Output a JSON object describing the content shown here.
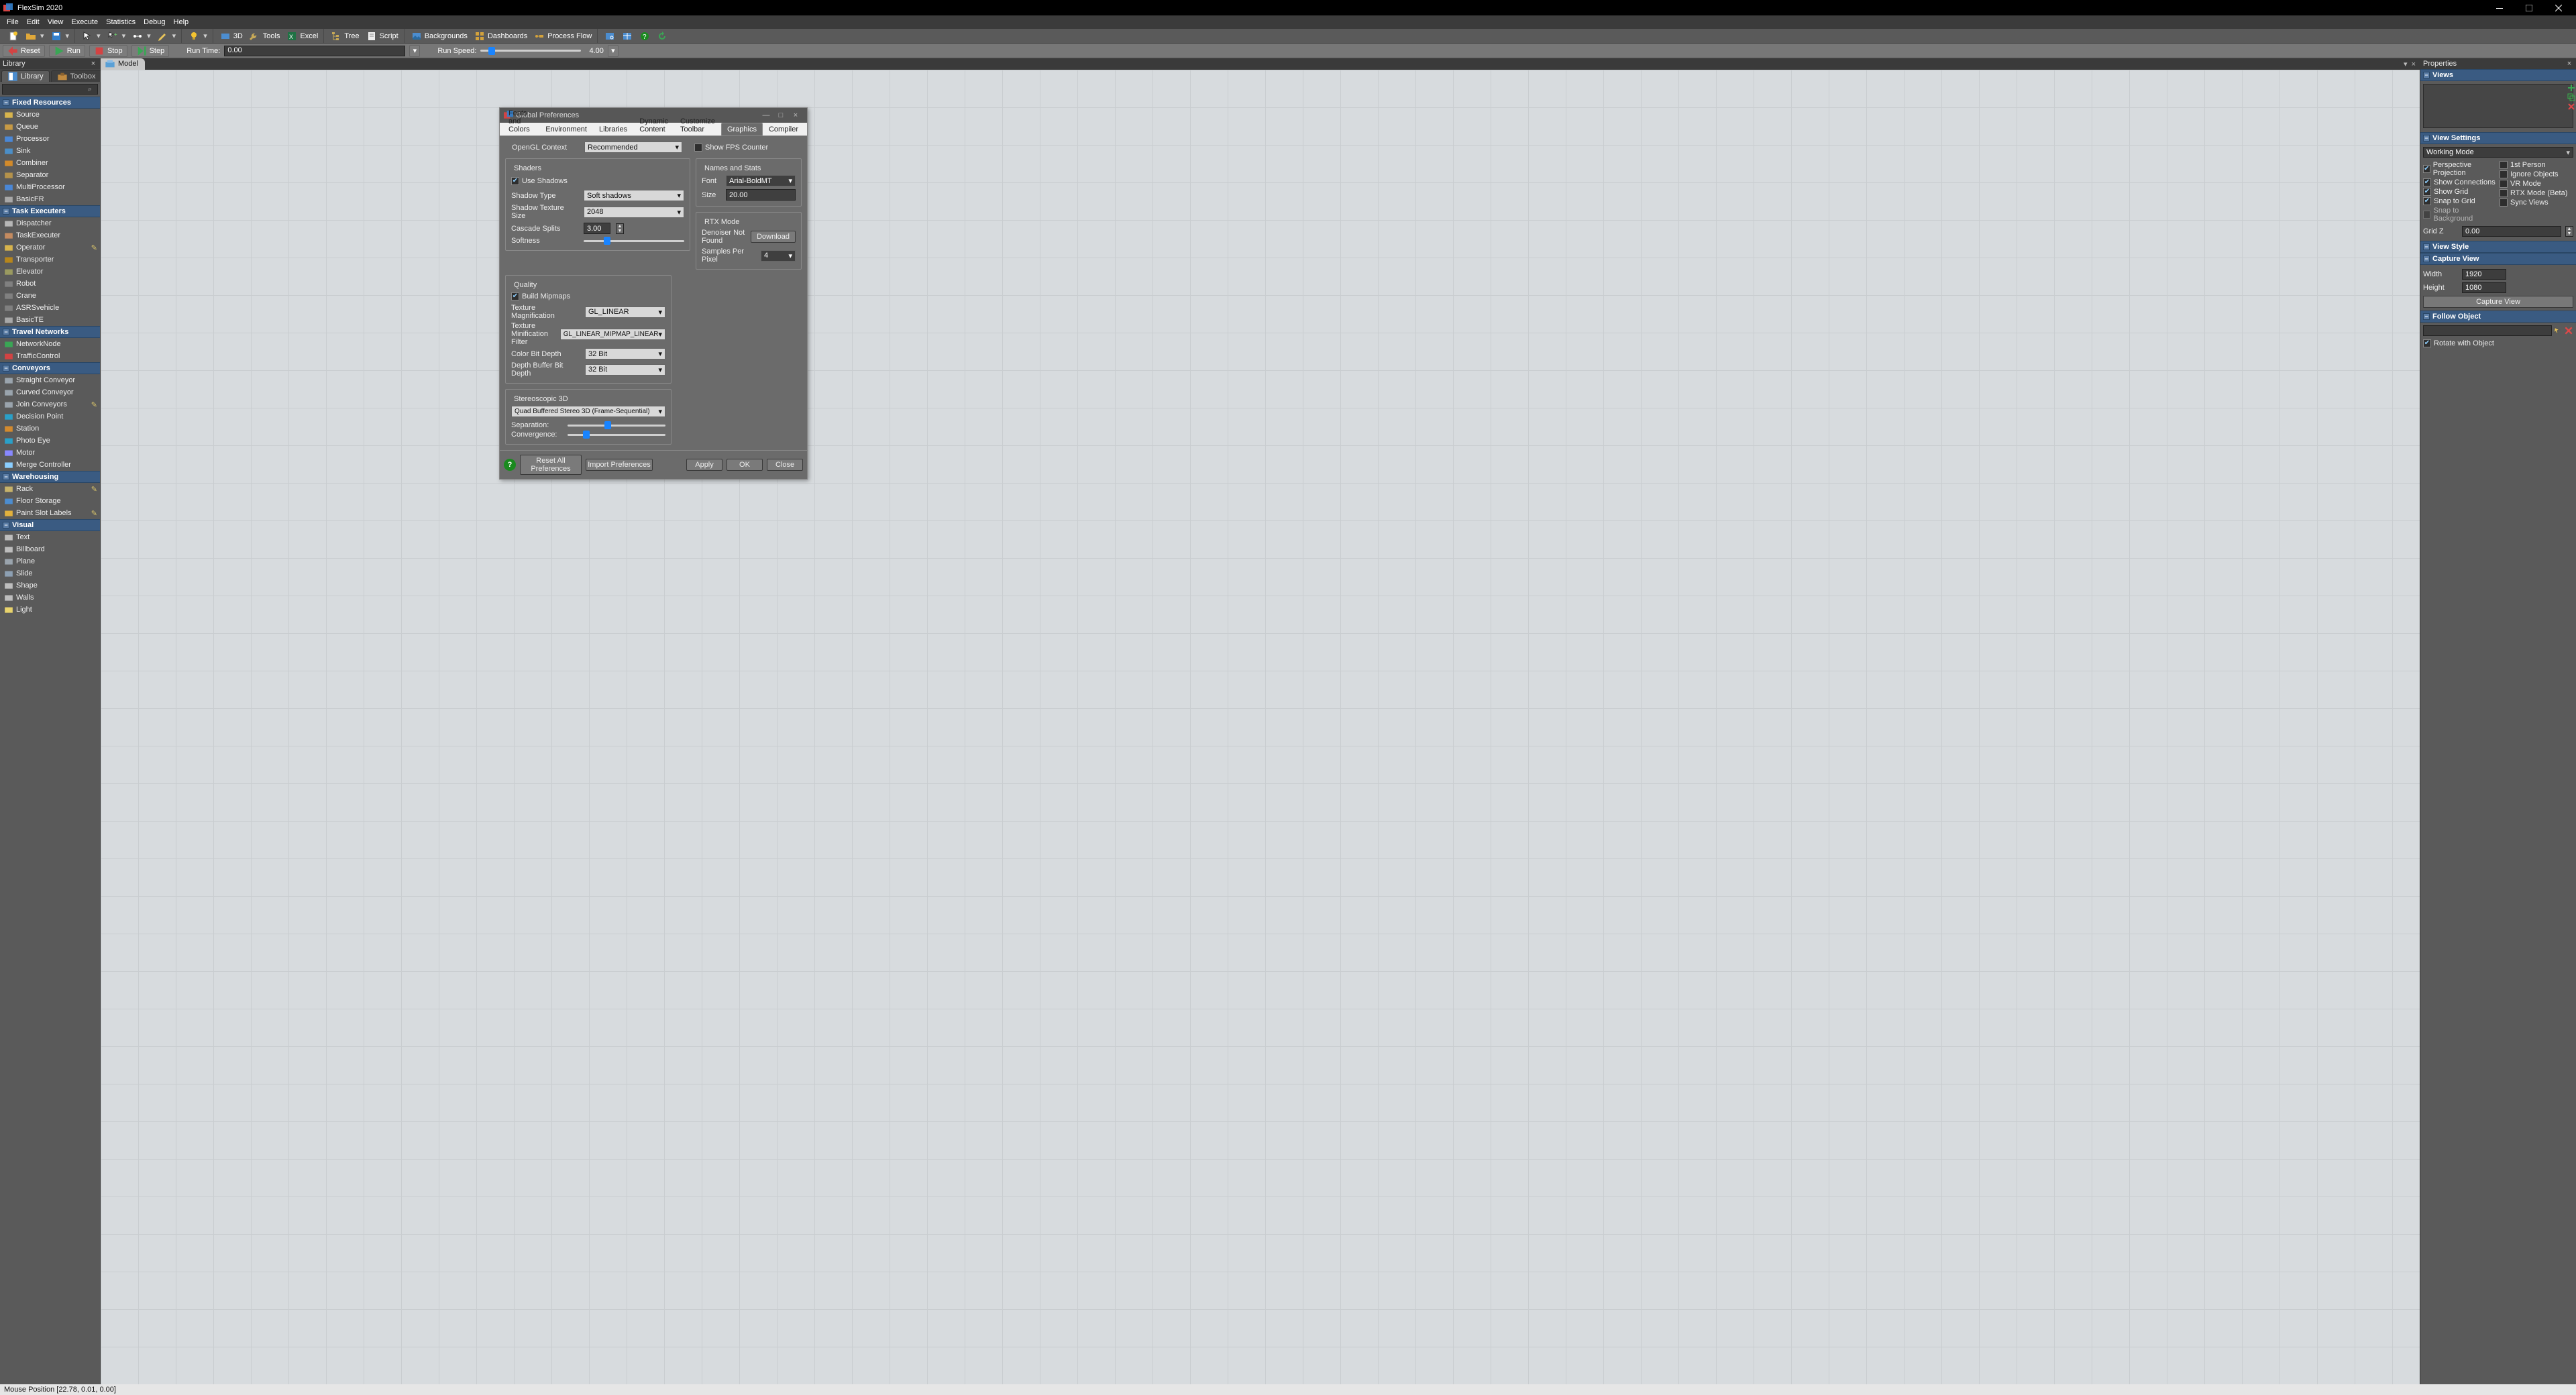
{
  "title": "FlexSim 2020",
  "menubar": [
    "File",
    "Edit",
    "View",
    "Execute",
    "Statistics",
    "Debug",
    "Help"
  ],
  "toolbar": {
    "groups": {
      "view": [
        {
          "name": "3d-toggle",
          "label": "3D"
        },
        {
          "name": "tools-menu",
          "label": "Tools"
        },
        {
          "name": "excel-button",
          "label": "Excel"
        }
      ],
      "tree": [
        {
          "name": "tree-button",
          "label": "Tree"
        },
        {
          "name": "script-button",
          "label": "Script"
        }
      ],
      "layout": [
        {
          "name": "backgrounds-button",
          "label": "Backgrounds"
        },
        {
          "name": "dashboards-button",
          "label": "Dashboards"
        },
        {
          "name": "process-flow-button",
          "label": "Process Flow"
        }
      ]
    }
  },
  "simbar": {
    "reset": "Reset",
    "run": "Run",
    "stop": "Stop",
    "step": "Step",
    "run_time_label": "Run Time:",
    "run_time_value": "0.00",
    "run_speed_label": "Run Speed:",
    "run_speed_value": "4.00",
    "run_speed_pct": 8
  },
  "library": {
    "header": "Library",
    "tabs": {
      "library": "Library",
      "toolbox": "Toolbox"
    },
    "search_placeholder": "",
    "categories": [
      {
        "name": "Fixed Resources",
        "items": [
          {
            "label": "Source",
            "c": "#d7b44d"
          },
          {
            "label": "Queue",
            "c": "#c79a45"
          },
          {
            "label": "Processor",
            "c": "#4a87d6"
          },
          {
            "label": "Sink",
            "c": "#4b8ec7"
          },
          {
            "label": "Combiner",
            "c": "#d28a2a"
          },
          {
            "label": "Separator",
            "c": "#b4924b"
          },
          {
            "label": "MultiProcessor",
            "c": "#4a87d6"
          },
          {
            "label": "BasicFR",
            "c": "#a8a8a8"
          }
        ]
      },
      {
        "name": "Task Executers",
        "items": [
          {
            "label": "Dispatcher",
            "c": "#b7b7b7"
          },
          {
            "label": "TaskExecuter",
            "c": "#c48b60"
          },
          {
            "label": "Operator",
            "c": "#d7b44d",
            "r": true
          },
          {
            "label": "Transporter",
            "c": "#b7861b"
          },
          {
            "label": "Elevator",
            "c": "#9a9a60"
          },
          {
            "label": "Robot",
            "c": "#808080"
          },
          {
            "label": "Crane",
            "c": "#808080"
          },
          {
            "label": "ASRSvehicle",
            "c": "#808080"
          },
          {
            "label": "BasicTE",
            "c": "#a8a8a8"
          }
        ]
      },
      {
        "name": "Travel Networks",
        "items": [
          {
            "label": "NetworkNode",
            "c": "#3aa655"
          },
          {
            "label": "TrafficControl",
            "c": "#d34343"
          }
        ]
      },
      {
        "name": "Conveyors",
        "items": [
          {
            "label": "Straight Conveyor",
            "c": "#9aa4ad"
          },
          {
            "label": "Curved Conveyor",
            "c": "#9aa4ad"
          },
          {
            "label": "Join Conveyors",
            "c": "#9aa4ad",
            "r": true
          },
          {
            "label": "Decision Point",
            "c": "#2aa0c8"
          },
          {
            "label": "Station",
            "c": "#d38a2e"
          },
          {
            "label": "Photo Eye",
            "c": "#2aa0c8"
          },
          {
            "label": "Motor",
            "c": "#8888ff"
          },
          {
            "label": "Merge Controller",
            "c": "#8aceff"
          }
        ]
      },
      {
        "name": "Warehousing",
        "items": [
          {
            "label": "Rack",
            "c": "#c7b26a",
            "r": true
          },
          {
            "label": "Floor Storage",
            "c": "#4c8dcf"
          },
          {
            "label": "Paint Slot Labels",
            "c": "#e2b13d",
            "r": true
          }
        ]
      },
      {
        "name": "Visual",
        "items": [
          {
            "label": "Text",
            "c": "#bdbdbd"
          },
          {
            "label": "Billboard",
            "c": "#bdbdbd"
          },
          {
            "label": "Plane",
            "c": "#9aa4ad"
          },
          {
            "label": "Slide",
            "c": "#8da0b3"
          },
          {
            "label": "Shape",
            "c": "#bdbdbd"
          },
          {
            "label": "Walls",
            "c": "#bdbdbd"
          },
          {
            "label": "Light",
            "c": "#e8d36c"
          }
        ]
      }
    ]
  },
  "view_tab": {
    "label": "Model"
  },
  "properties": {
    "header": "Properties",
    "views": {
      "header": "Views"
    },
    "view_settings": {
      "header": "View Settings",
      "mode": "Working Mode",
      "left": [
        {
          "label": "Perspective Projection",
          "on": true
        },
        {
          "label": "Show Connections",
          "on": true
        },
        {
          "label": "Show Grid",
          "on": true
        },
        {
          "label": "Snap to Grid",
          "on": true
        },
        {
          "label": "Snap to Background",
          "on": false,
          "disabled": true
        }
      ],
      "right": [
        {
          "label": "1st Person",
          "on": false
        },
        {
          "label": "Ignore Objects",
          "on": false
        },
        {
          "label": "VR Mode",
          "on": false
        },
        {
          "label": "RTX Mode (Beta)",
          "on": false
        },
        {
          "label": "Sync Views",
          "on": false
        }
      ],
      "grid_z_label": "Grid Z",
      "grid_z": "0.00"
    },
    "view_style": {
      "header": "View Style"
    },
    "capture_view": {
      "header": "Capture View",
      "width_label": "Width",
      "width": "1920",
      "height_label": "Height",
      "height": "1080",
      "button": "Capture View"
    },
    "follow": {
      "header": "Follow Object",
      "rotate_label": "Rotate with Object",
      "rotate_on": true
    }
  },
  "dialog": {
    "title": "Global Preferences",
    "tabs": [
      "Fonts and Colors",
      "Environment",
      "Libraries",
      "Dynamic Content",
      "Customize Toolbar",
      "Graphics",
      "Compiler"
    ],
    "active_tab": "Graphics",
    "top": {
      "opengl_label": "OpenGL Context",
      "opengl_value": "Recommended",
      "show_fps_label": "Show FPS Counter",
      "show_fps_on": false
    },
    "shaders": {
      "legend": "Shaders",
      "use_shadows_label": "Use Shadows",
      "use_shadows_on": true,
      "shadow_type_label": "Shadow Type",
      "shadow_type": "Soft shadows",
      "texture_size_label": "Shadow Texture Size",
      "texture_size": "2048",
      "cascade_label": "Cascade Splits",
      "cascade": "3.00",
      "softness_label": "Softness",
      "softness_pct": 20
    },
    "names": {
      "legend": "Names and Stats",
      "font_label": "Font",
      "font": "Arial-BoldMT",
      "size_label": "Size",
      "size": "20.00"
    },
    "rtx": {
      "legend": "RTX Mode",
      "status": "Denoiser Not Found",
      "download": "Download",
      "spp_label": "Samples Per Pixel",
      "spp": "4"
    },
    "quality": {
      "legend": "Quality",
      "build_mipmaps_label": "Build Mipmaps",
      "build_mipmaps_on": true,
      "tex_mag_label": "Texture Magnification",
      "tex_mag": "GL_LINEAR",
      "tex_min_label": "Texture Minification Filter",
      "tex_min": "GL_LINEAR_MIPMAP_LINEAR",
      "color_depth_label": "Color Bit Depth",
      "color_depth": "32 Bit",
      "depth_buf_label": "Depth Buffer Bit Depth",
      "depth_buf": "32 Bit"
    },
    "stereo": {
      "legend": "Stereoscopic 3D",
      "mode": "Quad Buffered Stereo 3D (Frame-Sequential)",
      "separation_label": "Separation:",
      "separation_pct": 38,
      "convergence_label": "Convergence:",
      "convergence_pct": 16
    },
    "footer": {
      "reset": "Reset All Preferences",
      "import": "Import Preferences",
      "apply": "Apply",
      "ok": "OK",
      "close": "Close"
    }
  },
  "statusbar": {
    "mouse": "Mouse Position [22.78, 0.01, 0.00]"
  }
}
